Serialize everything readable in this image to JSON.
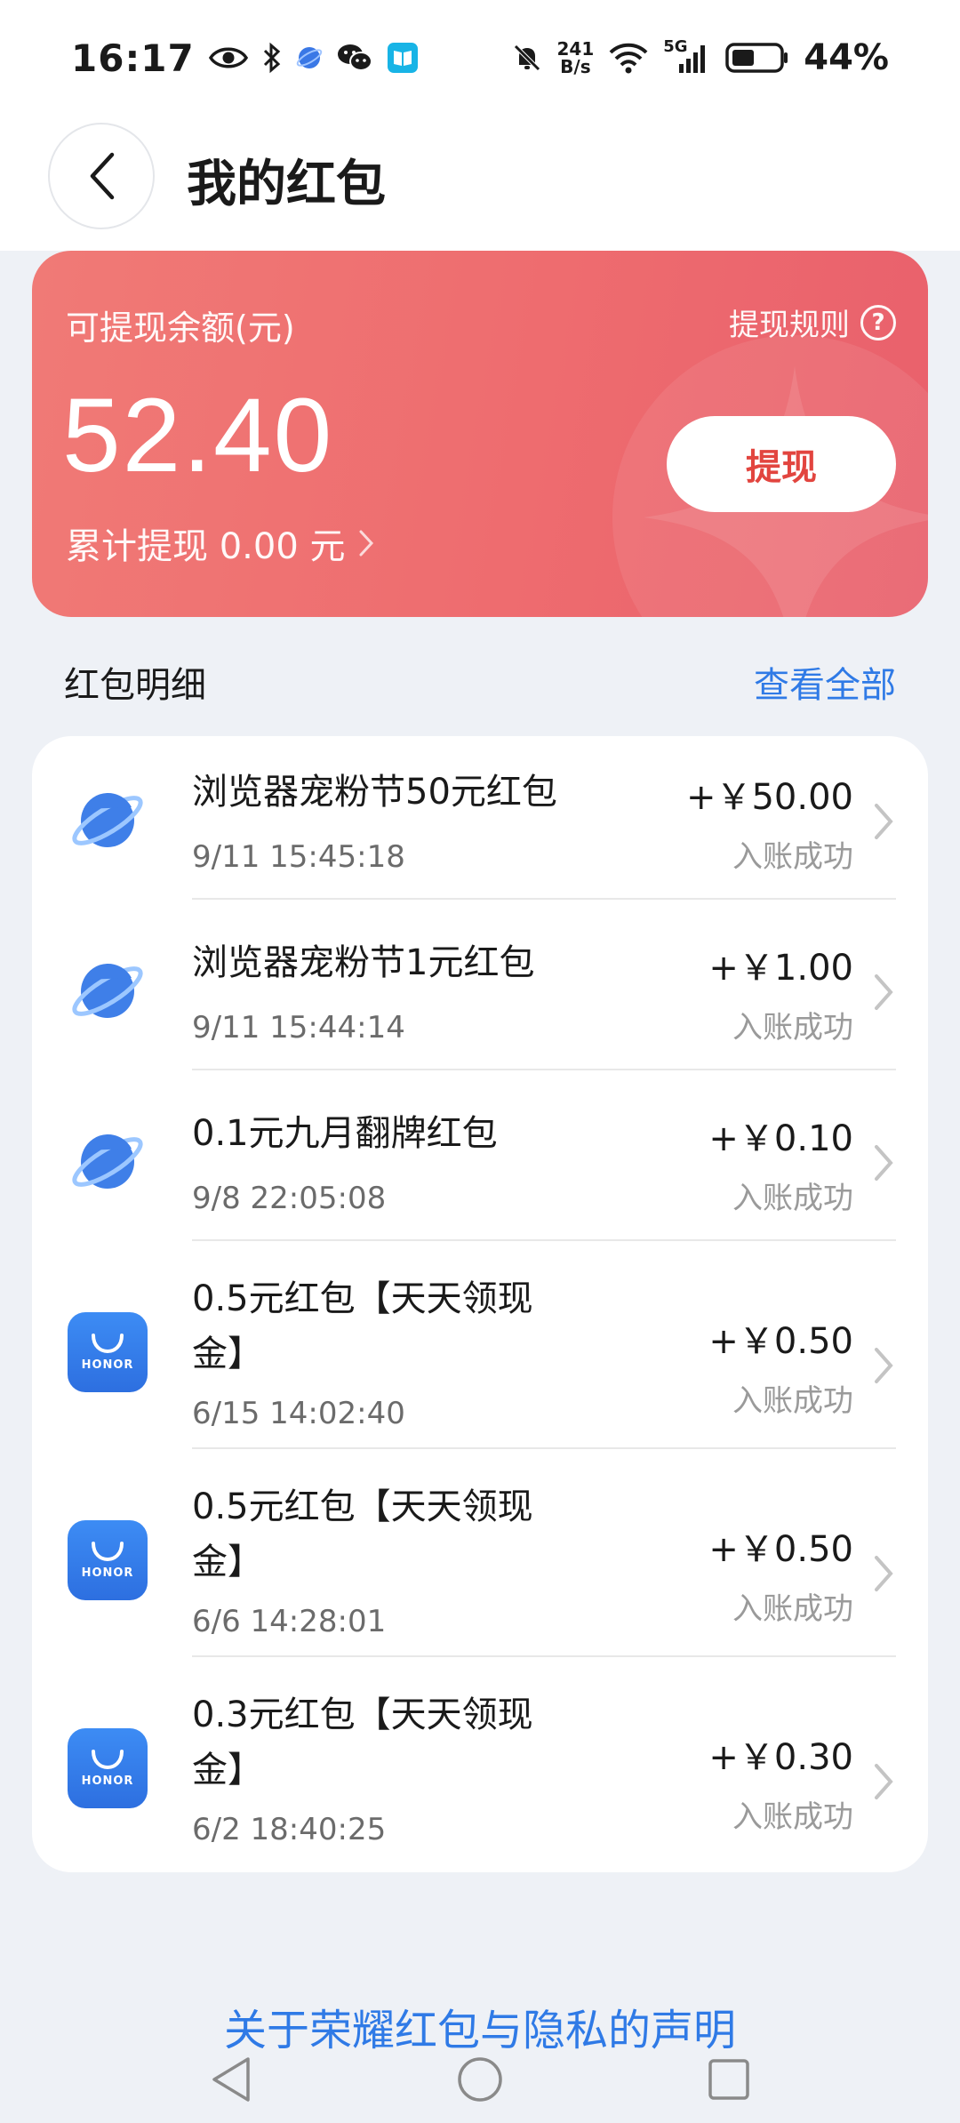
{
  "status_bar": {
    "time": "16:17",
    "net_speed_value": "241",
    "net_speed_unit": "B/s",
    "network_type": "5G",
    "battery": "44%"
  },
  "header": {
    "title": "我的红包"
  },
  "balance_card": {
    "label": "可提现余额(元)",
    "rules_label": "提现规则",
    "amount": "52.40",
    "withdraw_label": "提现",
    "total_withdrawn": "累计提现 0.00 元"
  },
  "section": {
    "title": "红包明细",
    "view_all": "查看全部"
  },
  "items": [
    {
      "icon": "planet-icon",
      "name": "浏览器宠粉节50元红包",
      "time": "9/11 15:45:18",
      "amount": "+￥50.00",
      "status": "入账成功"
    },
    {
      "icon": "planet-icon",
      "name": "浏览器宠粉节1元红包",
      "time": "9/11 15:44:14",
      "amount": "+￥1.00",
      "status": "入账成功"
    },
    {
      "icon": "planet-icon",
      "name": "0.1元九月翻牌红包",
      "time": "9/8 22:05:08",
      "amount": "+￥0.10",
      "status": "入账成功"
    },
    {
      "icon": "honor-bag-icon",
      "name": "0.5元红包【天天领现金】",
      "time": "6/15 14:02:40",
      "amount": "+￥0.50",
      "status": "入账成功"
    },
    {
      "icon": "honor-bag-icon",
      "name": "0.5元红包【天天领现金】",
      "time": "6/6 14:28:01",
      "amount": "+￥0.50",
      "status": "入账成功"
    },
    {
      "icon": "honor-bag-icon",
      "name": "0.3元红包【天天领现金】",
      "time": "6/2 18:40:25",
      "amount": "+￥0.30",
      "status": "入账成功"
    }
  ],
  "honor_logo_text": "HONOR",
  "footer": {
    "privacy_link": "关于荣耀红包与隐私的声明"
  },
  "colors": {
    "accent": "#2f7ae6",
    "card_start": "#f07a76",
    "card_end": "#e9606c",
    "withdraw_text": "#e2453f"
  }
}
